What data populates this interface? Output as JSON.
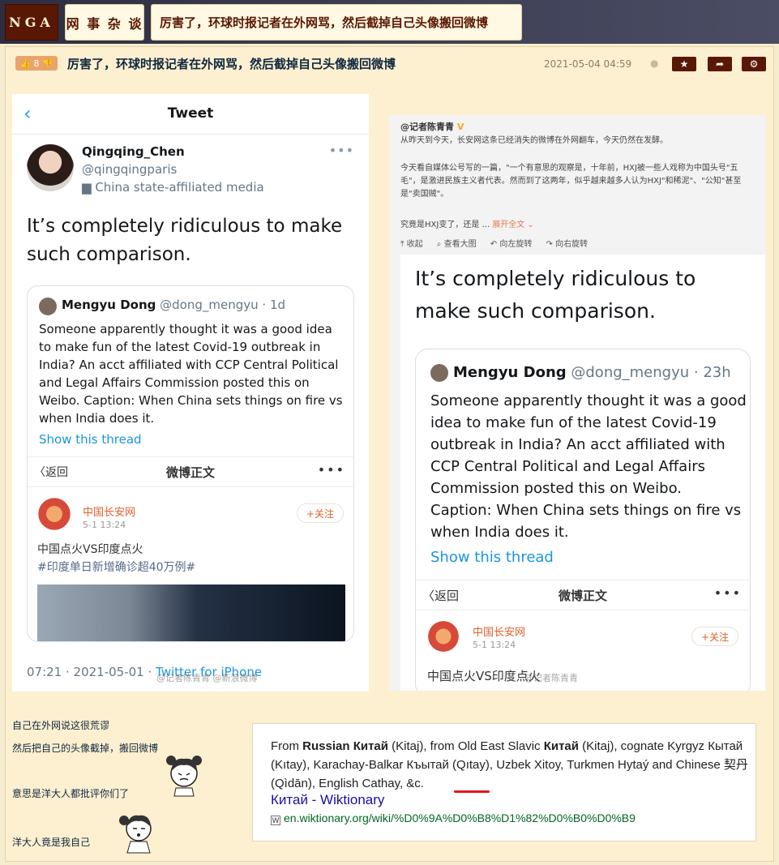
{
  "nav": {
    "logo": "NGA",
    "forum": "网 事 杂 谈",
    "thread_title": "厉害了，环球时报记者在外网骂，然后截掉自己头像搬回微博"
  },
  "post": {
    "votes": "8",
    "title": "厉害了，环球时报记者在外网骂，然后截掉自己头像搬回微博",
    "date": "2021-05-04 04:59",
    "buttons": {
      "favorite": "★",
      "share": "➦",
      "settings": "⚙"
    }
  },
  "tweet_left": {
    "header": "Tweet",
    "name": "Qingqing_Chen",
    "handle": "@qingqingparis",
    "affiliation": "China state-affiliated media",
    "text": "It’s completely ridiculous to make such comparison.",
    "quote": {
      "name": "Mengyu Dong",
      "handle": "@dong_mengyu · 1d",
      "text": "Someone apparently thought it was a good idea to make fun of the latest Covid-19 outbreak in India? An acct affiliated with CCP Central Political and Legal Affairs Commission posted this on Weibo. Caption: When China sets things on fire vs when India does it.",
      "link": "Show this thread"
    },
    "weibo": {
      "back": "〈返回",
      "title": "微博正文",
      "account": "中国长安网",
      "time": "5-1 13:24",
      "follow": "+关注",
      "line1": "中国点火VS印度点火",
      "line2": "#印度单日新增确诊超40万例#"
    },
    "footer_time": "07:21 · 2021-05-01 · ",
    "footer_source": "Twitter for iPhone"
  },
  "weibo_right": {
    "author": "@记者陈青青",
    "p1": "从昨天到今天，长安网这条已经消失的微博在外网翻车，今天仍然在发酵。",
    "p2": "今天看自媒体公号写的一篇，\"一个有意思的观察是，十年前，HXJ被一些人戏称为中国头号\"五毛\"，是激进民族主义者代表。然而到了这两年，似乎越来越多人认为HXJ\"和稀泥\"、\"公知\"甚至是\"卖国贼\"。",
    "p3": "究竟是HXJ变了，还是 ...",
    "expand": "展开全文 ⌄",
    "actions": [
      "⤒ 收起",
      "⌕ 查看大图",
      "↶ 向左旋转",
      "↷ 向右旋转"
    ],
    "text": "It’s completely ridiculous to make such comparison.",
    "quote": {
      "name": "Mengyu Dong",
      "handle": "@dong_mengyu · 23h",
      "text": "Someone apparently thought it was a good idea to make fun of the latest Covid-19 outbreak in India? An acct affiliated with CCP Central Political and Legal Affairs Commission posted this on Weibo. Caption: When China sets things on fire vs when India does it.",
      "link": "Show this thread"
    },
    "weibo": {
      "back": "〈返回",
      "title": "微博正文",
      "account": "中国长安网",
      "time": "5-1 13:24",
      "follow": "+关注",
      "line1": "中国点火VS印度点火"
    }
  },
  "body_lines": [
    "自己在外网说这很荒谬",
    "然后把自己的头像截掉，搬回微博",
    "意思是洋大人都批评你们了",
    "洋大人竟是我自己"
  ],
  "wiktionary": {
    "text_html_free_1": "From ",
    "bold_1": "Russian Китай",
    "text_2": " (Kitaj), from Old East Slavic ",
    "bold_2": "Китай",
    "text_3": " (Kitaj), cognate Kyrgyz Кытай (Kıtay), Karachay-Balkar Къытай (Qıtay), Uzbek Xitoy, Turkmen Hytaý and Chinese 契丹 (Qìdān), English Cathay, &c.",
    "title": "Китай - Wiktionary",
    "url": "en.wiktionary.org/wiki/%D0%9A%D0%B8%D1%82%D0%B0%D0%B9"
  }
}
